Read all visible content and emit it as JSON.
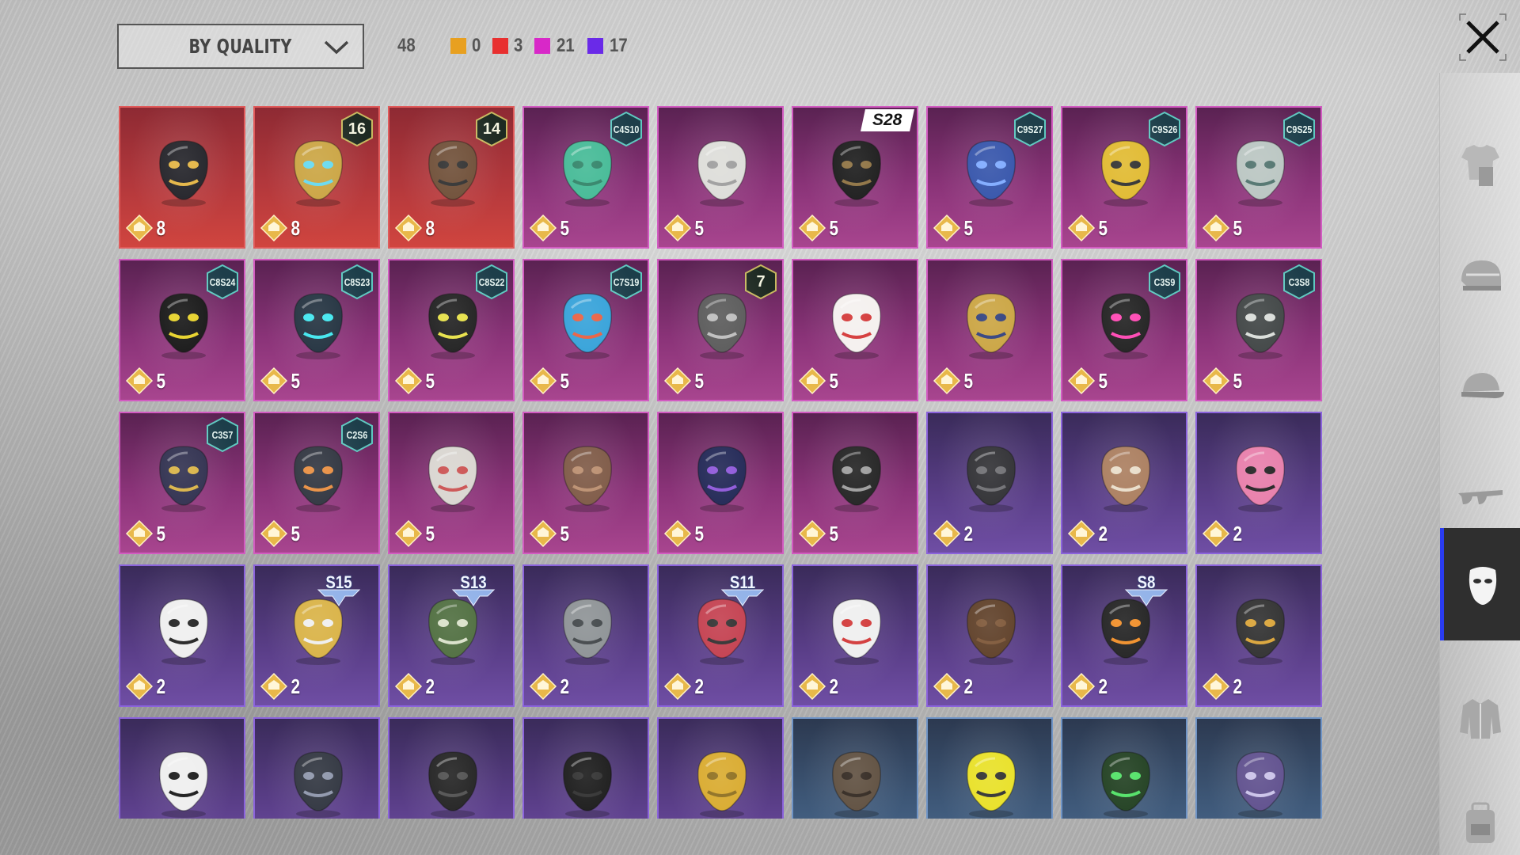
{
  "toolbar": {
    "sort_label": "BY QUALITY",
    "total_count": "48",
    "rarity_counts": [
      {
        "color": "#e8a020",
        "count": "0"
      },
      {
        "color": "#e83030",
        "count": "3"
      },
      {
        "color": "#d828c8",
        "count": "21"
      },
      {
        "color": "#6a2ae8",
        "count": "17"
      }
    ]
  },
  "items": [
    {
      "rarity": "red",
      "score": "8",
      "badge_type": "none",
      "badge": "",
      "art": "black-gold-helmet-mask"
    },
    {
      "rarity": "red",
      "score": "8",
      "badge_type": "level",
      "badge": "16",
      "art": "gold-blue-face-mask"
    },
    {
      "rarity": "red",
      "score": "8",
      "badge_type": "level",
      "badge": "14",
      "art": "bronze-samurai-mask"
    },
    {
      "rarity": "magenta",
      "score": "5",
      "badge_type": "hex",
      "badge": "C4S10",
      "art": "green-face-mask"
    },
    {
      "rarity": "magenta",
      "score": "5",
      "badge_type": "none",
      "badge": "",
      "art": "crying-cat-mask"
    },
    {
      "rarity": "magenta",
      "score": "5",
      "badge_type": "s28",
      "badge": "S28",
      "art": "black-cloth-mask"
    },
    {
      "rarity": "magenta",
      "score": "5",
      "badge_type": "hex",
      "badge": "C9S27",
      "art": "blue-respirator-mask"
    },
    {
      "rarity": "magenta",
      "score": "5",
      "badge_type": "hex",
      "badge": "C9S26",
      "art": "yellow-hex-mask"
    },
    {
      "rarity": "magenta",
      "score": "5",
      "badge_type": "hex",
      "badge": "C9S25",
      "art": "silver-spike-mask"
    },
    {
      "rarity": "magenta",
      "score": "5",
      "badge_type": "hex",
      "badge": "C8S24",
      "art": "yellow-visor-mask"
    },
    {
      "rarity": "magenta",
      "score": "5",
      "badge_type": "hex",
      "badge": "C8S23",
      "art": "neon-cyan-mask"
    },
    {
      "rarity": "magenta",
      "score": "5",
      "badge_type": "hex",
      "badge": "C8S22",
      "art": "black-ring-mask"
    },
    {
      "rarity": "magenta",
      "score": "5",
      "badge_type": "hex",
      "badge": "C7S19",
      "art": "tribal-blue-mask"
    },
    {
      "rarity": "magenta",
      "score": "5",
      "badge_type": "level",
      "badge": "7",
      "art": "wire-earpiece"
    },
    {
      "rarity": "magenta",
      "score": "5",
      "badge_type": "none",
      "badge": "",
      "art": "kitsune-mask"
    },
    {
      "rarity": "magenta",
      "score": "5",
      "badge_type": "none",
      "badge": "",
      "art": "gold-knight-mask"
    },
    {
      "rarity": "magenta",
      "score": "5",
      "badge_type": "hex",
      "badge": "C3S9",
      "art": "pink-gas-mask"
    },
    {
      "rarity": "magenta",
      "score": "5",
      "badge_type": "hex",
      "badge": "C3S8",
      "art": "grey-gas-mask"
    },
    {
      "rarity": "magenta",
      "score": "5",
      "badge_type": "hex",
      "badge": "C3S7",
      "art": "gold-chain-mask"
    },
    {
      "rarity": "magenta",
      "score": "5",
      "badge_type": "hex",
      "badge": "C2S6",
      "art": "orange-trim-mask"
    },
    {
      "rarity": "magenta",
      "score": "5",
      "badge_type": "none",
      "badge": "",
      "art": "skull-bandana"
    },
    {
      "rarity": "magenta",
      "score": "5",
      "badge_type": "none",
      "badge": "",
      "art": "plague-beak-mask"
    },
    {
      "rarity": "magenta",
      "score": "5",
      "badge_type": "none",
      "badge": "",
      "art": "galaxy-helmet"
    },
    {
      "rarity": "magenta",
      "score": "5",
      "badge_type": "none",
      "badge": "",
      "art": "skull-bandana-dark"
    },
    {
      "rarity": "purple",
      "score": "2",
      "badge_type": "none",
      "badge": "",
      "art": "grey-half-mask"
    },
    {
      "rarity": "purple",
      "score": "2",
      "badge_type": "none",
      "badge": "",
      "art": "mammoth-mask"
    },
    {
      "rarity": "purple",
      "score": "2",
      "badge_type": "none",
      "badge": "",
      "art": "pink-monkey-mask"
    },
    {
      "rarity": "purple",
      "score": "2",
      "badge_type": "none",
      "badge": "",
      "art": "white-eye-mask"
    },
    {
      "rarity": "purple",
      "score": "2",
      "badge_type": "season",
      "badge": "S15",
      "art": "gold-demon-mask"
    },
    {
      "rarity": "purple",
      "score": "2",
      "badge_type": "season",
      "badge": "S13",
      "art": "goggle-mask"
    },
    {
      "rarity": "purple",
      "score": "2",
      "badge_type": "none",
      "badge": "",
      "art": "silver-breather"
    },
    {
      "rarity": "purple",
      "score": "2",
      "badge_type": "season",
      "badge": "S11",
      "art": "red-half-mask"
    },
    {
      "rarity": "purple",
      "score": "2",
      "badge_type": "none",
      "badge": "",
      "art": "clown-mask"
    },
    {
      "rarity": "purple",
      "score": "2",
      "badge_type": "none",
      "badge": "",
      "art": "mustache"
    },
    {
      "rarity": "purple",
      "score": "2",
      "badge_type": "season",
      "badge": "S8",
      "art": "flame-bandana"
    },
    {
      "rarity": "purple",
      "score": "2",
      "badge_type": "none",
      "badge": "",
      "art": "studded-gold-mask"
    },
    {
      "rarity": "purple",
      "score": "",
      "badge_type": "none",
      "badge": "",
      "art": "panda-cloth-mask"
    },
    {
      "rarity": "purple",
      "score": "",
      "badge_type": "none",
      "badge": "",
      "art": "dark-skull-mask"
    },
    {
      "rarity": "purple",
      "score": "",
      "badge_type": "none",
      "badge": "",
      "art": "black-iron-mask"
    },
    {
      "rarity": "purple",
      "score": "",
      "badge_type": "none",
      "badge": "",
      "art": "black-bandana"
    },
    {
      "rarity": "purple",
      "score": "",
      "badge_type": "none",
      "badge": "",
      "art": "gold-sequin-mask"
    },
    {
      "rarity": "blue",
      "score": "",
      "badge_type": "none",
      "badge": "",
      "art": "rusty-skull-mask"
    },
    {
      "rarity": "blue",
      "score": "",
      "badge_type": "none",
      "badge": "",
      "art": "yellow-dot-bandana"
    },
    {
      "rarity": "blue",
      "score": "",
      "badge_type": "none",
      "badge": "",
      "art": "web-bandana"
    },
    {
      "rarity": "blue",
      "score": "",
      "badge_type": "none",
      "badge": "",
      "art": "purple-smile-mask"
    }
  ],
  "sidebar": {
    "tabs": [
      {
        "name": "outfit-tab",
        "icon": "outfit-icon",
        "active": false
      },
      {
        "name": "helmet-tab",
        "icon": "helmet-icon",
        "active": false
      },
      {
        "name": "hat-tab",
        "icon": "cap-icon",
        "active": false
      },
      {
        "name": "eyewear-tab",
        "icon": "glasses-icon",
        "active": false
      },
      {
        "name": "mask-tab",
        "icon": "mask-icon",
        "active": true
      },
      {
        "name": "jacket-tab",
        "icon": "jacket-icon",
        "active": false
      },
      {
        "name": "backpack-tab",
        "icon": "backpack-icon",
        "active": false
      }
    ]
  },
  "colors": {
    "active_tab_accent": "#2a3cf0",
    "score_icon_gold": "#e8b84a"
  }
}
